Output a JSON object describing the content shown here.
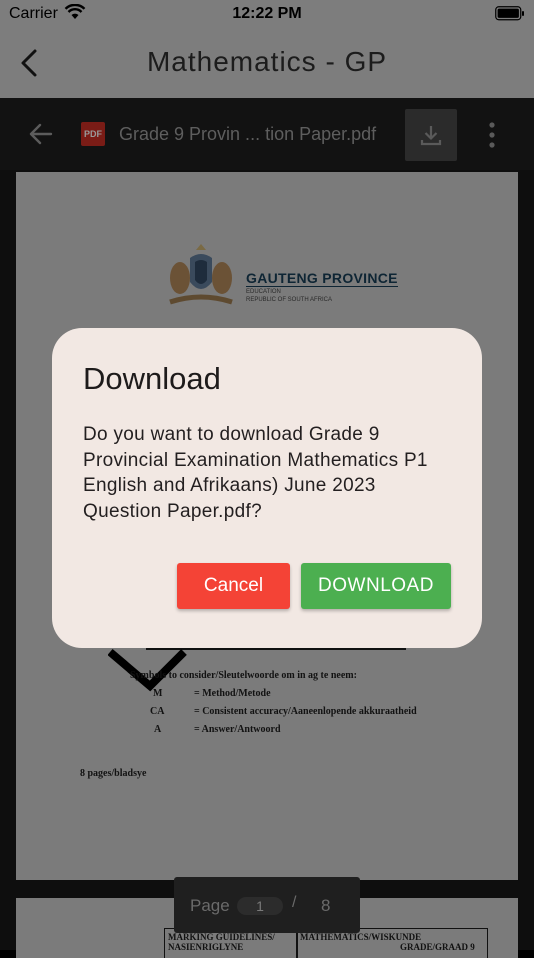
{
  "status_bar": {
    "carrier": "Carrier",
    "time": "12:22 PM"
  },
  "app_bar": {
    "title": "Mathematics - GP"
  },
  "pdf_toolbar": {
    "file_badge": "PDF",
    "file_name": "Grade 9 Provin ... tion Paper.pdf"
  },
  "document": {
    "page1": {
      "logo_title": "GAUTENG PROVINCE",
      "logo_line1": "EDUCATION",
      "logo_line2": "REPUBLIC OF SOUTH AFRICA",
      "note": "Symbols to consider/Sleutelwoorde om in ag te neem:",
      "abbreviations": [
        {
          "code": "M",
          "meaning": "= Method/Metode"
        },
        {
          "code": "CA",
          "meaning": "= Consistent accuracy/Aaneenlopende akkuraatheid"
        },
        {
          "code": "A",
          "meaning": "= Answer/Antwoord"
        }
      ],
      "pages": "8 pages/bladsye"
    },
    "page2": {
      "left_header": "MARKING GUIDELINES/",
      "left_header_2": "NASIENRIGLYNE",
      "right_header": "MATHEMATICS/WISKUNDE",
      "right_header_2": "GRADE/GRAAD 9"
    }
  },
  "pager": {
    "label": "Page",
    "current": "1",
    "separator": "/",
    "total": "8"
  },
  "dialog": {
    "title": "Download",
    "message": "Do you want to download Grade 9 Provincial Examination Mathematics P1 English and Afrikaans) June 2023 Question Paper.pdf?",
    "cancel_label": "Cancel",
    "download_label": "DOWNLOAD"
  },
  "colors": {
    "cancel": "#f44336",
    "download": "#4caf50",
    "dialog_bg": "#f2e8e3"
  }
}
